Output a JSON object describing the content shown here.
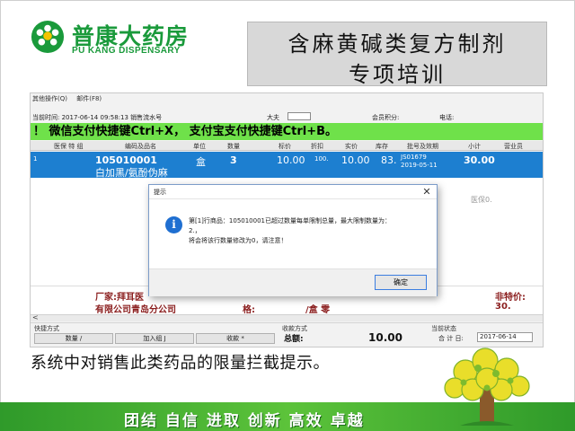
{
  "header": {
    "logo_cn": "普康大药房",
    "logo_en": "PU KANG DISPENSARY",
    "title_line1": "含麻黄碱类复方制剂",
    "title_line2": "专项培训"
  },
  "app": {
    "menu": [
      "其他操作(Q)",
      "邮件(F8)"
    ],
    "info": {
      "current_time": "当前时间:  2017-06-14 09:58:13 销售流水号",
      "doctor_label": "大夫",
      "member_points_label": "会员积分:",
      "phone_label": "电话:"
    },
    "hint": "！ 微信支付快捷键Ctrl+X， 支付宝支付快捷键Ctrl+B。",
    "columns": [
      "医保 特 组",
      "编码及品名",
      "单位",
      "数量",
      "标价",
      "折扣",
      "实价",
      "库存",
      "批号及效期",
      "小计",
      "营业员"
    ],
    "row": {
      "index": "1",
      "code": "105010001",
      "name": "白加黑/氨酚伪麻",
      "unit": "盒",
      "qty": "3",
      "price": "10.00",
      "discount": "100.",
      "actual": "10.00",
      "stock": "83.",
      "batch": "JS01679",
      "expiry": "2019-05-11",
      "subtotal": "30.00"
    },
    "ghost_col": "医保0.",
    "detail": {
      "manufacturer_line1": "厂家:拜耳医",
      "manufacturer_line2": "有限公司青岛分公司",
      "spec_label": "格:",
      "spec_value": "/盒  零",
      "right_label": "非特价:",
      "right_value": "30."
    },
    "bottom": {
      "shortcut_label": "快捷方式",
      "btn_qty": "数量 /",
      "btn_add_group": "加入组 J",
      "btn_collect": "收款 *",
      "pay_method_label": "收款方式",
      "total_amount_label": "总额:",
      "total_amount_value": "10.00",
      "status_label": "当前状态",
      "total_label": "合 计 日:",
      "date": "2017-06-14"
    }
  },
  "dialog": {
    "title": "提示",
    "close": "✕",
    "message_line1": "第[1]行商品：105010001已超过数量每单限制总量，最大限制数量为：",
    "message_line2": "2.，",
    "message_line3": "将会将该行数量修改为0，请注意！",
    "ok": "确定"
  },
  "caption": "系统中对销售此类药品的限量拦截提示。",
  "slogan": "团结  自信  进取  创新  高效  卓越",
  "colors": {
    "brand_green": "#1a9a3b",
    "hint_green": "#6fe14a",
    "selected_row_blue": "#1d7fd0",
    "detail_red": "#8b1e1e",
    "footer_green": "#5cc33a"
  }
}
